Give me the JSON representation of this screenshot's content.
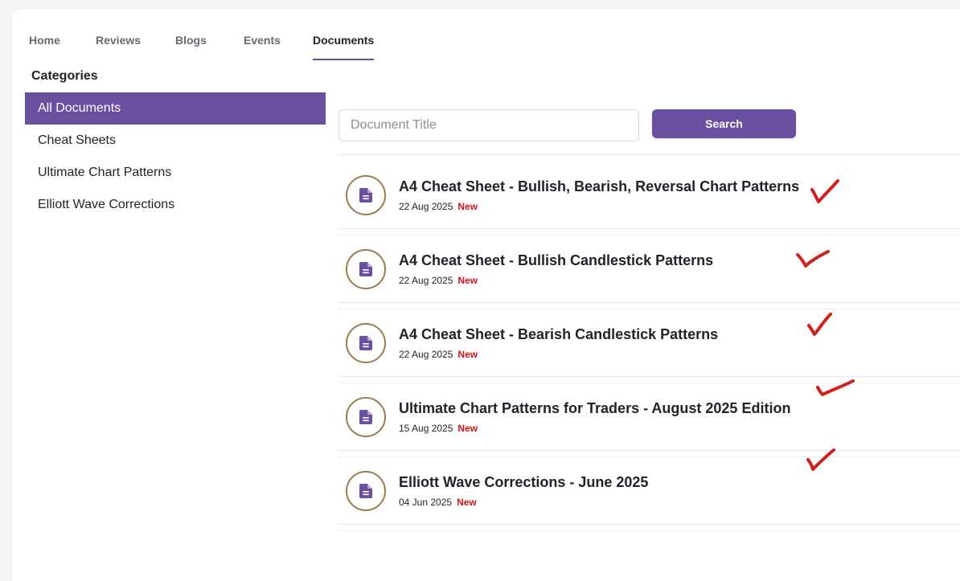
{
  "nav": {
    "tabs": [
      {
        "label": "Home"
      },
      {
        "label": "Reviews"
      },
      {
        "label": "Blogs"
      },
      {
        "label": "Events"
      },
      {
        "label": "Documents"
      }
    ],
    "active_tab": "Documents"
  },
  "sidebar": {
    "title": "Categories",
    "items": [
      {
        "label": "All Documents"
      },
      {
        "label": "Cheat Sheets"
      },
      {
        "label": "Ultimate Chart Patterns"
      },
      {
        "label": "Elliott Wave Corrections"
      }
    ],
    "active_item": "All Documents"
  },
  "search": {
    "placeholder": "Document Title",
    "value": "",
    "button_label": "Search"
  },
  "documents": [
    {
      "title": "A4 Cheat Sheet - Bullish, Bearish, Reversal Chart Patterns",
      "date": "22 Aug 2025",
      "badge": "New",
      "icon": "document-icon",
      "annotation": "red-checkmark"
    },
    {
      "title": "A4 Cheat Sheet - Bullish Candlestick Patterns",
      "date": "22 Aug 2025",
      "badge": "New",
      "icon": "document-icon",
      "annotation": "red-checkmark"
    },
    {
      "title": "A4 Cheat Sheet - Bearish Candlestick Patterns",
      "date": "22 Aug 2025",
      "badge": "New",
      "icon": "document-icon",
      "annotation": "red-checkmark"
    },
    {
      "title": "Ultimate Chart Patterns for Traders - August 2025 Edition",
      "date": "15 Aug 2025",
      "badge": "New",
      "icon": "document-icon",
      "annotation": "red-checkmark"
    },
    {
      "title": "Elliott Wave Corrections - June 2025",
      "date": "04 Jun 2025",
      "badge": "New",
      "icon": "document-icon",
      "annotation": "red-checkmark"
    }
  ],
  "colors": {
    "accent": "#6a4fa0",
    "icon_ring": "#9a7b4f",
    "badge_new": "#d1141b",
    "checkmark": "#d0211c"
  }
}
